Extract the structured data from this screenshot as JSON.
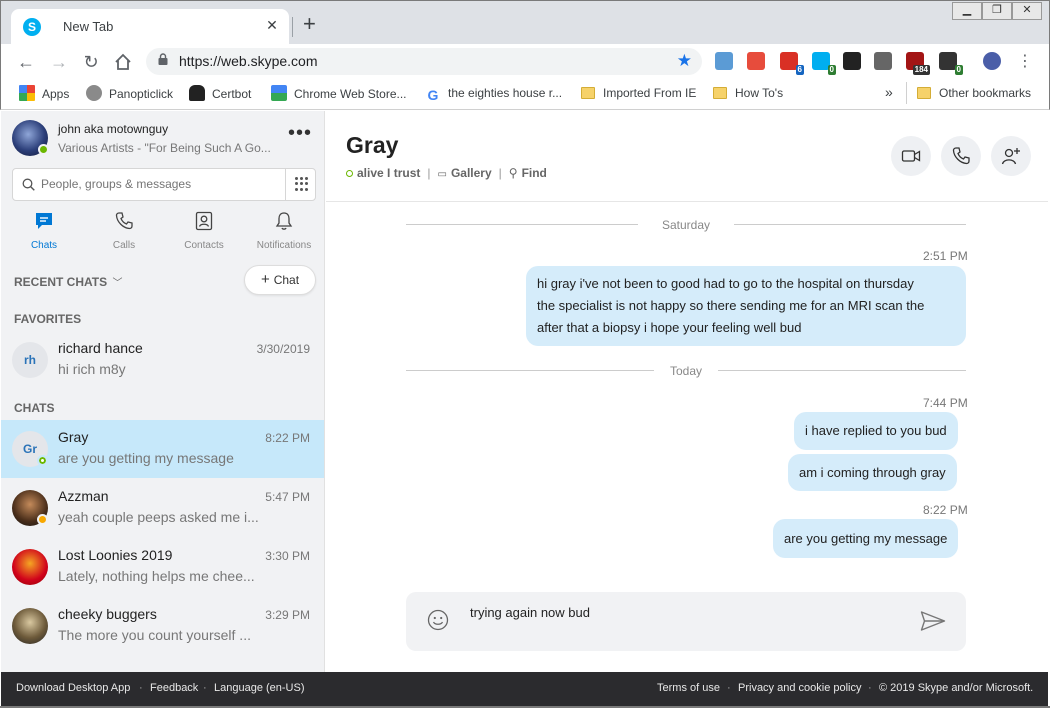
{
  "browser": {
    "tab_title": "New Tab",
    "tab_favicon": "S",
    "url": "https://web.skype.com",
    "extensions": [
      {
        "name": "download-ext-icon",
        "color": "#5b9bd5",
        "badge": ""
      },
      {
        "name": "gem-ext-icon",
        "color": "#e74c3c",
        "badge": ""
      },
      {
        "name": "red-c-ext-icon",
        "color": "#d93025",
        "badge": "6"
      },
      {
        "name": "ghostery-ext-icon",
        "color": "#00aef0",
        "badge": "0"
      },
      {
        "name": "spiral-ext-icon",
        "color": "#222222",
        "badge": ""
      },
      {
        "name": "scissors-ext-icon",
        "color": "#666666",
        "badge": ""
      },
      {
        "name": "red-building-ext-icon",
        "color": "#a31515",
        "badge": "184"
      },
      {
        "name": "car-ext-icon",
        "color": "#333333",
        "badge": "0"
      },
      {
        "name": "music-ext-icon",
        "color": "#4a5ea8",
        "badge": ""
      }
    ],
    "bookmarks": [
      {
        "label": "Apps",
        "icon": "apps-grid-icon"
      },
      {
        "label": "Panopticlick",
        "icon": "panopticlick-icon"
      },
      {
        "label": "Certbot",
        "icon": "certbot-icon"
      },
      {
        "label": "Chrome Web Store...",
        "icon": "chrome-store-icon"
      },
      {
        "label": "the eighties house r...",
        "icon": "google-icon"
      },
      {
        "label": "Imported From IE",
        "icon": "folder-icon"
      },
      {
        "label": "How To's",
        "icon": "folder-icon"
      }
    ],
    "overflow": "»",
    "other_bookmarks": "Other bookmarks"
  },
  "profile": {
    "name": "john aka motownguy",
    "mood": "Various Artists - \"For Being Such A Go..."
  },
  "search": {
    "placeholder": "People, groups & messages"
  },
  "nav": [
    {
      "label": "Chats",
      "icon": "chat-icon",
      "active": true
    },
    {
      "label": "Calls",
      "icon": "phone-icon",
      "active": false
    },
    {
      "label": "Contacts",
      "icon": "contacts-icon",
      "active": false
    },
    {
      "label": "Notifications",
      "icon": "bell-icon",
      "active": false
    }
  ],
  "sidebar": {
    "recent_label": "RECENT CHATS",
    "new_chat_label": "Chat",
    "favorites_label": "FAVORITES",
    "chats_label": "CHATS",
    "favorites": [
      {
        "name": "richard hance",
        "preview": "hi rich m8y",
        "time": "3/30/2019",
        "initials": "rh"
      }
    ],
    "chats": [
      {
        "name": "Gray",
        "preview": "are you getting my message",
        "time": "8:22 PM",
        "initials": "Gr",
        "selected": true
      },
      {
        "name": "Azzman",
        "preview": "yeah couple peeps asked me i...",
        "time": "5:47 PM",
        "initials": ""
      },
      {
        "name": "Lost Loonies 2019",
        "preview": "Lately, nothing helps me chee...",
        "time": "3:30 PM",
        "initials": ""
      },
      {
        "name": "cheeky buggers",
        "preview": "The more you count yourself ...",
        "time": "3:29 PM",
        "initials": ""
      }
    ]
  },
  "conversation": {
    "title": "Gray",
    "mood": "alive I trust",
    "gallery": "Gallery",
    "find": "Find",
    "dividers": [
      "Saturday",
      "Today"
    ],
    "messages": [
      {
        "time": "2:51 PM",
        "text": "hi gray i've not been to good had to go to the hospital on thursday the specialist is not happy so there sending me for an MRI scan the after that a biopsy i hope your feeling well bud"
      },
      {
        "time": "7:44 PM",
        "text": "i have replied to you bud"
      },
      {
        "time": "",
        "text": "am i coming through gray"
      },
      {
        "time": "8:22 PM",
        "text": "are you getting my message"
      }
    ],
    "message_lines": [
      "hi gray i've not been to good had to go to the hospital on thursday",
      "the specialist is not happy so there sending me for an MRI scan the",
      "after that a biopsy i hope your feeling well bud"
    ],
    "composer_value": "trying again now bud"
  },
  "footer": {
    "download": "Download Desktop App",
    "feedback": "Feedback",
    "language": "Language (en-US)",
    "terms": "Terms of use",
    "privacy": "Privacy and cookie policy",
    "copyright": "© 2019 Skype and/or Microsoft."
  },
  "colors": {
    "accent": "#0078d4",
    "bubble": "#d5ecfa",
    "selected_chat": "#c6e8fa",
    "presence_online": "#6bb700"
  }
}
